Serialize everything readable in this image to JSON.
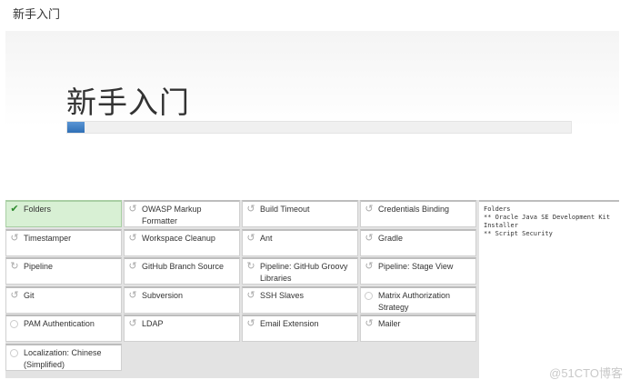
{
  "window": {
    "title": "新手入门"
  },
  "hero": {
    "heading": "新手入门",
    "progress_fraction": 0.035
  },
  "plugins": [
    {
      "label": "Folders",
      "status": "installed",
      "icon": "check-icon"
    },
    {
      "label": "OWASP Markup Formatter",
      "status": "pending",
      "icon": "refresh-icon"
    },
    {
      "label": "Build Timeout",
      "status": "pending",
      "icon": "refresh-icon"
    },
    {
      "label": "Credentials Binding",
      "status": "pending",
      "icon": "refresh-icon"
    },
    {
      "label": "Timestamper",
      "status": "pending",
      "icon": "refresh-icon"
    },
    {
      "label": "Workspace Cleanup",
      "status": "pending",
      "icon": "refresh-icon"
    },
    {
      "label": "Ant",
      "status": "pending",
      "icon": "refresh-icon"
    },
    {
      "label": "Gradle",
      "status": "pending",
      "icon": "refresh-icon"
    },
    {
      "label": "Pipeline",
      "status": "installing",
      "icon": "sync-icon"
    },
    {
      "label": "GitHub Branch Source",
      "status": "pending",
      "icon": "refresh-icon"
    },
    {
      "label": "Pipeline: GitHub Groovy Libraries",
      "status": "installing",
      "icon": "sync-icon"
    },
    {
      "label": "Pipeline: Stage View",
      "status": "pending",
      "icon": "refresh-icon"
    },
    {
      "label": "Git",
      "status": "pending",
      "icon": "refresh-icon"
    },
    {
      "label": "Subversion",
      "status": "pending",
      "icon": "refresh-icon"
    },
    {
      "label": "SSH Slaves",
      "status": "pending",
      "icon": "refresh-icon"
    },
    {
      "label": "Matrix Authorization Strategy",
      "status": "queued",
      "icon": "circle-icon"
    },
    {
      "label": "PAM Authentication",
      "status": "queued",
      "icon": "circle-icon"
    },
    {
      "label": "LDAP",
      "status": "pending",
      "icon": "refresh-icon"
    },
    {
      "label": "Email Extension",
      "status": "pending",
      "icon": "refresh-icon"
    },
    {
      "label": "Mailer",
      "status": "pending",
      "icon": "refresh-icon"
    },
    {
      "label": "Localization: Chinese (Simplified)",
      "status": "queued",
      "icon": "circle-icon"
    }
  ],
  "log": {
    "lines": [
      "Folders",
      "** Oracle Java SE Development Kit Installer",
      "** Script Security"
    ]
  },
  "watermark": "@51CTO博客",
  "colors": {
    "selected_bg": "#d8f0d4",
    "progress": "#2f6fb6",
    "check": "#2d8a2d"
  }
}
